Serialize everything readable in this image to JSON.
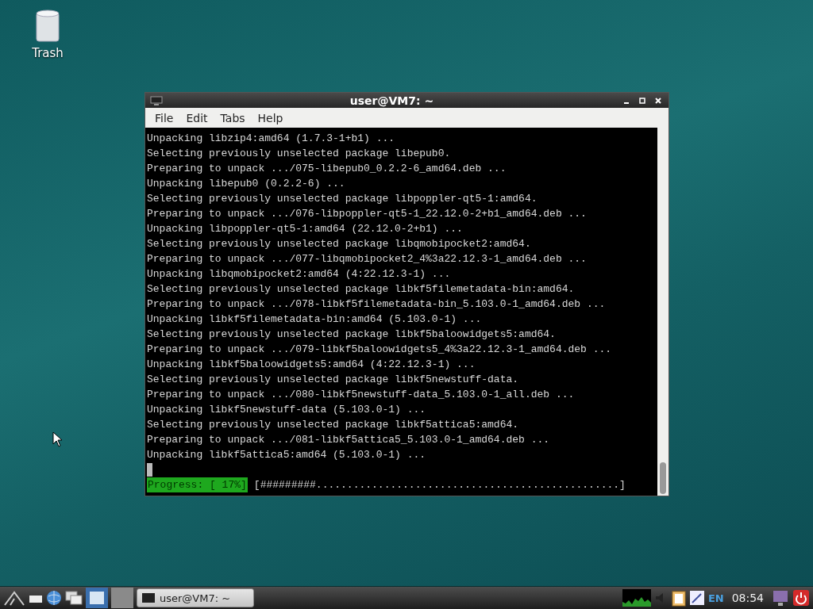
{
  "desktop_icons": [
    {
      "label": "Trash"
    }
  ],
  "window": {
    "title": "user@VM7: ~",
    "menu": [
      "File",
      "Edit",
      "Tabs",
      "Help"
    ],
    "lines": [
      "Unpacking libzip4:amd64 (1.7.3-1+b1) ...",
      "Selecting previously unselected package libepub0.",
      "Preparing to unpack .../075-libepub0_0.2.2-6_amd64.deb ...",
      "Unpacking libepub0 (0.2.2-6) ...",
      "Selecting previously unselected package libpoppler-qt5-1:amd64.",
      "Preparing to unpack .../076-libpoppler-qt5-1_22.12.0-2+b1_amd64.deb ...",
      "Unpacking libpoppler-qt5-1:amd64 (22.12.0-2+b1) ...",
      "Selecting previously unselected package libqmobipocket2:amd64.",
      "Preparing to unpack .../077-libqmobipocket2_4%3a22.12.3-1_amd64.deb ...",
      "Unpacking libqmobipocket2:amd64 (4:22.12.3-1) ...",
      "Selecting previously unselected package libkf5filemetadata-bin:amd64.",
      "Preparing to unpack .../078-libkf5filemetadata-bin_5.103.0-1_amd64.deb ...",
      "Unpacking libkf5filemetadata-bin:amd64 (5.103.0-1) ...",
      "Selecting previously unselected package libkf5baloowidgets5:amd64.",
      "Preparing to unpack .../079-libkf5baloowidgets5_4%3a22.12.3-1_amd64.deb ...",
      "Unpacking libkf5baloowidgets5:amd64 (4:22.12.3-1) ...",
      "Selecting previously unselected package libkf5newstuff-data.",
      "Preparing to unpack .../080-libkf5newstuff-data_5.103.0-1_all.deb ...",
      "Unpacking libkf5newstuff-data (5.103.0-1) ...",
      "Selecting previously unselected package libkf5attica5:amd64.",
      "Preparing to unpack .../081-libkf5attica5_5.103.0-1_amd64.deb ...",
      "Unpacking libkf5attica5:amd64 (5.103.0-1) ..."
    ],
    "progress": {
      "label": "Progress: [ 17%]",
      "bar": "[#########.................................................]"
    }
  },
  "taskbar": {
    "tasks": [
      {
        "label": "user@VM7: ~",
        "selected": false
      }
    ],
    "keyboard_layout": "EN",
    "clock": "08:54"
  }
}
